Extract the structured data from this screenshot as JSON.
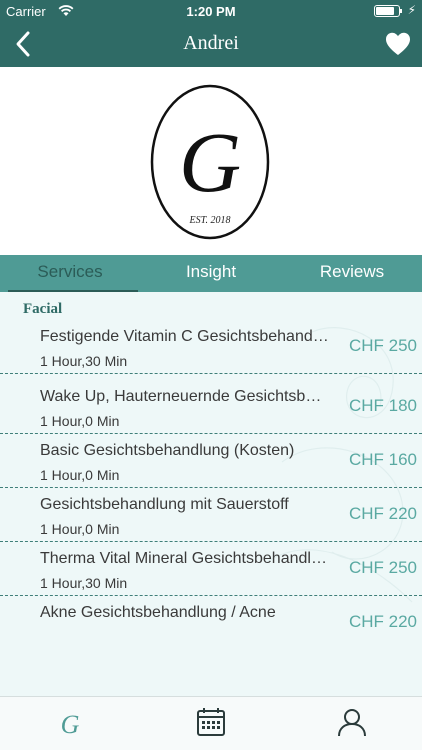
{
  "status_bar": {
    "carrier": "Carrier",
    "time": "1:20 PM",
    "battery_level": 0.8
  },
  "nav": {
    "title": "Andrei",
    "back_icon": "chevron-left-icon",
    "favorite_icon": "heart-icon"
  },
  "logo": {
    "initial": "G",
    "est": "EST. 2018"
  },
  "tabs": [
    {
      "label": "Services",
      "active": true
    },
    {
      "label": "Insight",
      "active": false
    },
    {
      "label": "Reviews",
      "active": false
    }
  ],
  "section": {
    "title": "Facial"
  },
  "services": [
    {
      "name": "Festigende Vitamin C Gesichtsbehandlung",
      "duration": "1 Hour,30 Min",
      "price": "CHF 250"
    },
    {
      "name": "Wake Up, Hauterneuernde Gesichtsbehandlung",
      "duration": "1 Hour,0 Min",
      "price": "CHF 180"
    },
    {
      "name": "Basic Gesichtsbehandlung (Kosten)",
      "duration": "1 Hour,0 Min",
      "price": "CHF 160"
    },
    {
      "name": "Gesichtsbehandlung mit Sauerstoff",
      "duration": "1 Hour,0 Min",
      "price": "CHF 220"
    },
    {
      "name": "Therma Vital Mineral Gesichtsbehandlung",
      "duration": "1 Hour,30 Min",
      "price": "CHF 250"
    },
    {
      "name": "Akne Gesichtsbehandlung  /  Acne",
      "duration": "",
      "price": "CHF 220"
    }
  ],
  "tabbar": {
    "items": [
      "salon-logo-icon",
      "calendar-icon",
      "profile-icon"
    ]
  },
  "colors": {
    "header": "#2f6b66",
    "tabs": "#4f9b95",
    "price": "#5aa9a2",
    "content_bg": "#eef8f8"
  }
}
